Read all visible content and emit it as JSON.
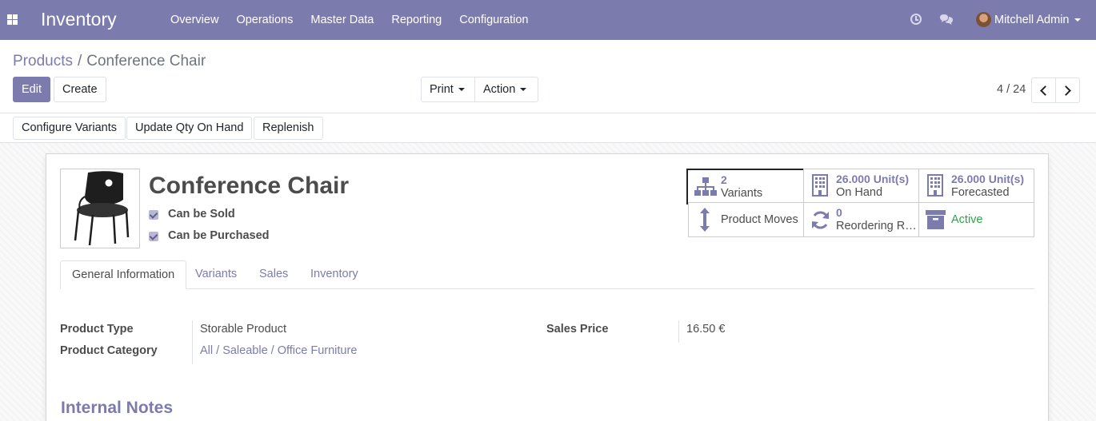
{
  "navbar": {
    "app_name": "Inventory",
    "menu": [
      "Overview",
      "Operations",
      "Master Data",
      "Reporting",
      "Configuration"
    ],
    "user": "Mitchell Admin"
  },
  "breadcrumb": {
    "parent": "Products",
    "separator": "/",
    "current": "Conference Chair"
  },
  "buttons": {
    "edit": "Edit",
    "create": "Create",
    "print": "Print",
    "action": "Action"
  },
  "pager": {
    "value": "4 / 24"
  },
  "statusbar": {
    "configure_variants": "Configure Variants",
    "update_qty": "Update Qty On Hand",
    "replenish": "Replenish"
  },
  "product": {
    "name": "Conference Chair",
    "can_be_sold_label": "Can be Sold",
    "can_be_sold": true,
    "can_be_purchased_label": "Can be Purchased",
    "can_be_purchased": true
  },
  "smart_buttons": {
    "variants_num": "2",
    "variants_label": "Variants",
    "on_hand_num": "26.000 Unit(s)",
    "on_hand_label": "On Hand",
    "forecasted_num": "26.000 Unit(s)",
    "forecasted_label": "Forecasted",
    "moves_label": "Product Moves",
    "reordering_num": "0",
    "reordering_label": "Reordering R…",
    "active_label": "Active"
  },
  "tabs": [
    "General Information",
    "Variants",
    "Sales",
    "Inventory"
  ],
  "fields": {
    "product_type_label": "Product Type",
    "product_type": "Storable Product",
    "product_category_label": "Product Category",
    "product_category": "All / Saleable / Office Furniture",
    "sales_price_label": "Sales Price",
    "sales_price": "16.50 €"
  },
  "internal_notes_title": "Internal Notes",
  "colors": {
    "brand": "#7c7bad",
    "active_green": "#28a745"
  }
}
